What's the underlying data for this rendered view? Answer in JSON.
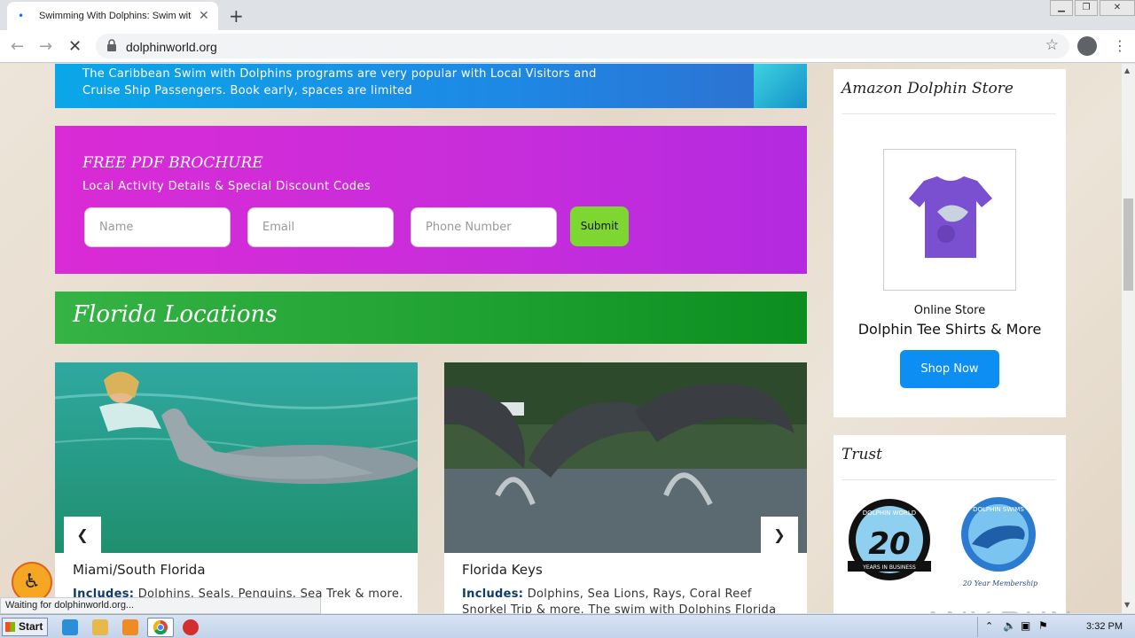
{
  "browser": {
    "tab_title": "Swimming With Dolphins: Swim with Dolphins",
    "tab_close": "✕",
    "new_tab": "+",
    "url": "dolphinworld.org",
    "status": "Waiting for dolphinworld.org..."
  },
  "hero": {
    "text": "The Caribbean Swim with Dolphins programs are very popular with Local Visitors and Cruise Ship Passengers. Book early, spaces are limited"
  },
  "brochure": {
    "title": "FREE PDF BROCHURE",
    "subtitle": "Local Activity Details & Special Discount Codes",
    "name_placeholder": "Name",
    "email_placeholder": "Email",
    "phone_placeholder": "Phone Number",
    "submit_label": "Submit"
  },
  "florida": {
    "title": "Florida Locations"
  },
  "cards": [
    {
      "title": "Miami/South Florida",
      "includes_label": "Includes:",
      "text": " Dolphins, Seals, Penguins, Sea Trek & more. you get the"
    },
    {
      "title": "Florida Keys",
      "includes_label": "Includes:",
      "text": " Dolphins, Sea Lions, Rays, Coral Reef Snorkel Trip & more. The swim with Dolphins Florida Keys and"
    }
  ],
  "store": {
    "title": "Amazon Dolphin Store",
    "label": "Online Store",
    "product": "Dolphin Tee Shirts & More",
    "button": "Shop Now"
  },
  "trust": {
    "title": "Trust",
    "badge1_top": "DOLPHIN WORLD",
    "badge1_num": "20",
    "badge1_bottom": "YEARS IN BUSINESS",
    "badge2_top": "DOLPHIN SWIMS",
    "badge2_bottom": "20 Year Membership"
  },
  "watermark": "ANY.RUN",
  "taskbar": {
    "start": "Start",
    "time": "3:32 PM"
  },
  "colors": {
    "hero": "#1e88e5",
    "brochure": "#c72ddb",
    "florida": "#1ea030",
    "submit": "#7ed631",
    "shop": "#0d8ef2"
  }
}
